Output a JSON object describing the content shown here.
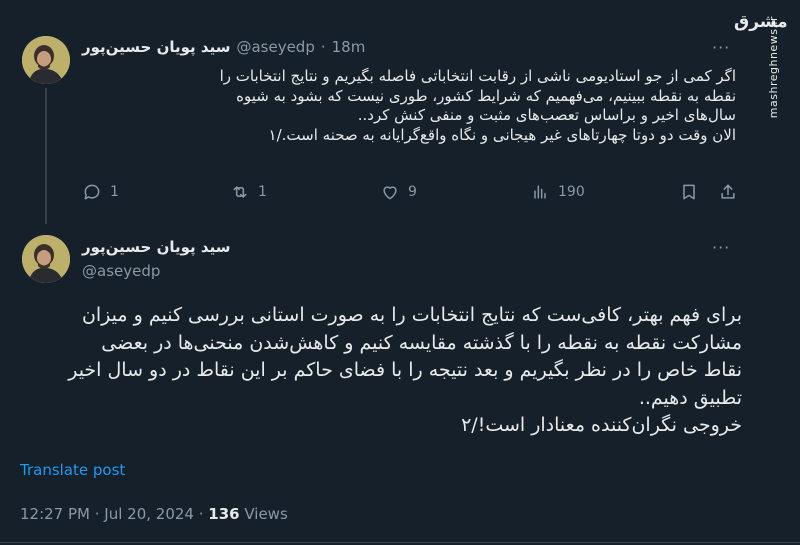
{
  "tweet1": {
    "display_name": "سید پویان حسین‌پور",
    "handle": "@aseyedp",
    "separator": "·",
    "time_ago": "18m",
    "more": "···",
    "lines": [
      "اگر کمی از جو استادیومی ناشی از رقابت انتخاباتی فاصله بگیریم و نتایج انتخابات را",
      "نقطه به نقطه ببینیم، می‌فهمیم که شرایط کشور، طوری نیست که بشود به شیوه",
      "سال‌های اخیر و براساس تعصب‌های مثبت و منفی کنش کرد..",
      "الان وقت دو دوتا چهارتاهای غیر هیجانی و نگاه واقع‌گرایانه به صحنه است./۱"
    ],
    "actions": {
      "replies": "1",
      "reposts": "1",
      "likes": "9",
      "views": "190"
    }
  },
  "tweet2": {
    "display_name": "سید پویان حسین‌پور",
    "handle": "@aseyedp",
    "more": "···",
    "lines": [
      "برای فهم بهتر، کافی‌ست که نتایج انتخابات را به صورت استانی بررسی کنیم و میزان",
      "مشارکت نقطه به نقطه را با گذشته مقایسه کنیم و کاهش‌شدن منحنی‌ها در بعضی",
      "نقاط خاص را در نظر بگیریم و بعد نتیجه را با فضای حاکم بر این نقاط در دو سال اخیر",
      "تطبیق دهیم..",
      "خروجی نگران‌کننده  معنادار است!/۲"
    ],
    "translate": "Translate post",
    "timestamp": "12:27 PM · Jul 20, 2024 · ",
    "views_count": "136",
    "views_label": " Views"
  },
  "watermark": {
    "logo_text": "مشرق",
    "url": "mashreghnews.ir"
  },
  "icons": [
    "reply-icon",
    "repost-icon",
    "like-icon",
    "views-icon",
    "bookmark-icon",
    "share-icon"
  ]
}
